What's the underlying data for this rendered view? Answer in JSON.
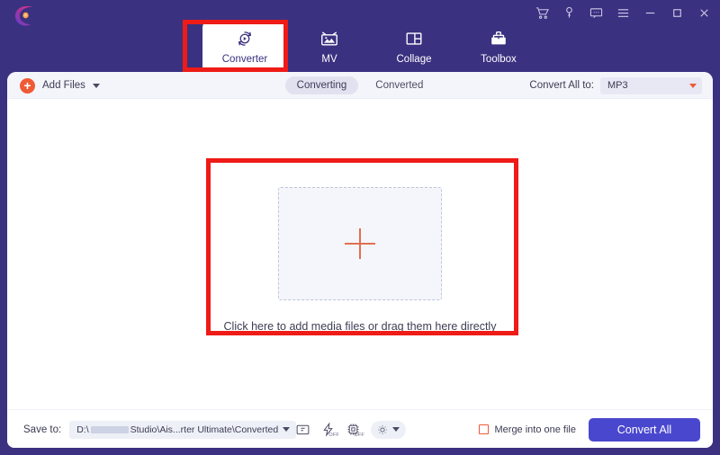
{
  "app": {
    "brand_logo": "aiseesoft-swirl-logo",
    "header_bg": "#3a3180",
    "accent_orange": "#ef5a36",
    "accent_blue": "#4a47cf",
    "annotation_color": "#ee1b16"
  },
  "window_controls": [
    {
      "name": "cart-icon",
      "label": "Cart"
    },
    {
      "name": "key-icon",
      "label": "Register"
    },
    {
      "name": "feedback-icon",
      "label": "Feedback"
    },
    {
      "name": "menu-icon",
      "label": "Menu"
    },
    {
      "name": "minimize-icon",
      "label": "Minimize"
    },
    {
      "name": "maximize-icon",
      "label": "Maximize"
    },
    {
      "name": "close-icon",
      "label": "Close"
    }
  ],
  "tabs": [
    {
      "label": "Converter",
      "icon": "converter-icon",
      "active": true
    },
    {
      "label": "MV",
      "icon": "mv-icon",
      "active": false
    },
    {
      "label": "Collage",
      "icon": "collage-icon",
      "active": false
    },
    {
      "label": "Toolbox",
      "icon": "toolbox-icon",
      "active": false
    }
  ],
  "toolbar": {
    "add_files_label": "Add Files",
    "segments": [
      {
        "label": "Converting",
        "selected": true
      },
      {
        "label": "Converted",
        "selected": false
      }
    ],
    "convert_all_to_label": "Convert All to:",
    "convert_all_to_value": "MP3"
  },
  "dropzone": {
    "plus_icon": "plus-icon",
    "hint": "Click here to add media files or drag them here directly"
  },
  "bottom": {
    "save_to_label": "Save to:",
    "path_prefix": "D:\\",
    "path_suffix": "Studio\\Ais...rter Ultimate\\Converted",
    "tools": [
      {
        "name": "open-folder-icon",
        "badge": ""
      },
      {
        "name": "hardware-accel-icon",
        "badge": "OFF"
      },
      {
        "name": "gpu-accel-icon",
        "badge": "OFF"
      },
      {
        "name": "settings-gear-icon",
        "badge": ""
      }
    ],
    "merge_label": "Merge into one file",
    "merge_checked": false,
    "convert_all_button": "Convert All"
  }
}
